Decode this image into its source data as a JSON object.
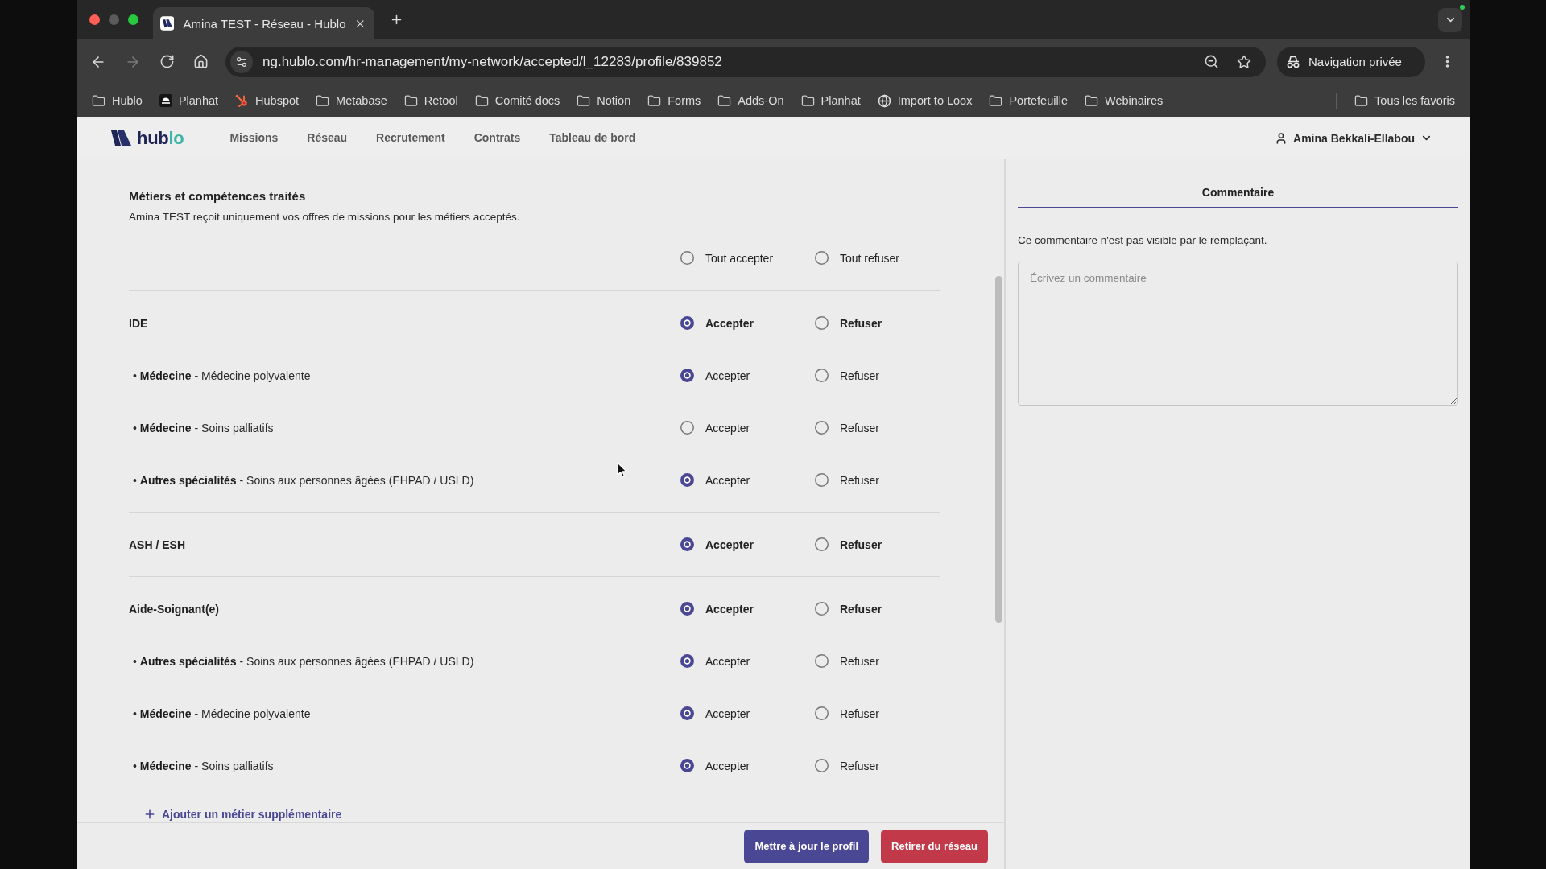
{
  "browser": {
    "tabs": [
      {
        "title": "Amina TEST - Réseau - Hublo",
        "selected": true
      }
    ],
    "address": {
      "url": "ng.hublo.com/hr-management/my-network/accepted/l_12283/profile/839852"
    },
    "profile": {
      "label": "Navigation privée"
    },
    "bookmarks": [
      {
        "label": "Hublo",
        "kind": "folder"
      },
      {
        "label": "Planhat",
        "kind": "app"
      },
      {
        "label": "Hubspot",
        "kind": "sprocket"
      },
      {
        "label": "Metabase",
        "kind": "folder"
      },
      {
        "label": "Retool",
        "kind": "folder"
      },
      {
        "label": "Comité docs",
        "kind": "folder"
      },
      {
        "label": "Notion",
        "kind": "folder"
      },
      {
        "label": "Forms",
        "kind": "folder"
      },
      {
        "label": "Adds-On",
        "kind": "folder"
      },
      {
        "label": "Planhat",
        "kind": "folder"
      },
      {
        "label": "Import to Loox",
        "kind": "globe"
      },
      {
        "label": "Portefeuille",
        "kind": "folder"
      },
      {
        "label": "Webinaires",
        "kind": "folder"
      }
    ],
    "all_bookmarks": {
      "label": "Tous les favoris"
    }
  },
  "app": {
    "logo": [
      {
        "text": "hub",
        "color": "#1f2557"
      },
      {
        "text": "lo",
        "color": "#3cb5a6"
      }
    ],
    "nav": [
      {
        "label": "Missions",
        "selected": false
      },
      {
        "label": "Réseau",
        "selected": false
      },
      {
        "label": "Recrutement",
        "selected": false
      },
      {
        "label": "Contrats",
        "selected": false
      },
      {
        "label": "Tableau de bord",
        "selected": false
      }
    ],
    "user": {
      "name": "Amina Bekkali-Ellabou"
    }
  },
  "skills": {
    "title": "Métiers et compétences traités",
    "description": "Amina TEST reçoit uniquement vos offres de missions pour les métiers acceptés.",
    "bulk_options": [
      {
        "label": "Tout accepter",
        "selected": false
      },
      {
        "label": "Tout refuser",
        "selected": false
      }
    ],
    "groups": [
      {
        "name": "IDE",
        "options": [
          {
            "label": "Accepter",
            "selected": true
          },
          {
            "label": "Refuser",
            "selected": false
          }
        ],
        "children": [
          {
            "text": "• **Médecine** - Médecine polyvalente",
            "options": [
              {
                "label": "Accepter",
                "selected": true
              },
              {
                "label": "Refuser",
                "selected": false
              }
            ]
          },
          {
            "text": "• **Médecine** - Soins palliatifs",
            "options": [
              {
                "label": "Accepter",
                "selected": false
              },
              {
                "label": "Refuser",
                "selected": false
              }
            ]
          },
          {
            "text": "• **Autres spécialités** - Soins aux personnes âgées (EHPAD / USLD)",
            "options": [
              {
                "label": "Accepter",
                "selected": true
              },
              {
                "label": "Refuser",
                "selected": false
              }
            ]
          }
        ]
      },
      {
        "name": "ASH / ESH",
        "options": [
          {
            "label": "Accepter",
            "selected": true
          },
          {
            "label": "Refuser",
            "selected": false
          }
        ]
      },
      {
        "name": "Aide-Soignant(e)",
        "options": [
          {
            "label": "Accepter",
            "selected": true
          },
          {
            "label": "Refuser",
            "selected": false
          }
        ],
        "children": [
          {
            "text": "• **Autres spécialités** - Soins aux personnes âgées (EHPAD / USLD)",
            "options": [
              {
                "label": "Accepter",
                "selected": true
              },
              {
                "label": "Refuser",
                "selected": false
              }
            ]
          },
          {
            "text": "• **Médecine** - Médecine polyvalente",
            "options": [
              {
                "label": "Accepter",
                "selected": true
              },
              {
                "label": "Refuser",
                "selected": false
              }
            ]
          },
          {
            "text": "• **Médecine** - Soins palliatifs",
            "options": [
              {
                "label": "Accepter",
                "selected": true
              },
              {
                "label": "Refuser",
                "selected": false
              }
            ]
          }
        ]
      }
    ],
    "add_link": "Ajouter un métier supplémentaire"
  },
  "comment": {
    "tabs": [
      {
        "label": "Commentaire",
        "selected": true
      }
    ],
    "note": "Ce commentaire n'est pas visible par le remplaçant.",
    "field": {
      "placeholder": "Écrivez un commentaire"
    }
  },
  "actions": [
    {
      "label": "Mettre à jour le profil",
      "kind": "primary"
    },
    {
      "label": "Retirer du réseau",
      "kind": "danger"
    }
  ]
}
